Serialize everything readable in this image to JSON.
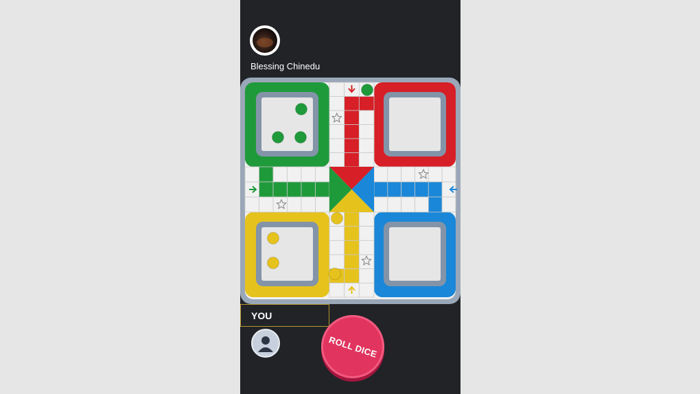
{
  "opponent": {
    "name": "Blessing Chinedu",
    "avatar_icon": "profile-photo"
  },
  "player": {
    "label": "YOU",
    "avatar_icon": "default-user-icon"
  },
  "roll_button": {
    "label": "ROLL DICE",
    "color": "#e1345f"
  },
  "board": {
    "colors": {
      "green": "#1f9a3b",
      "red": "#d61f26",
      "yellow": "#e6c21d",
      "blue": "#1a87d8",
      "frame": "#9aa7b8",
      "cell": "#f1f1f1"
    },
    "tokens": [
      {
        "color": "green",
        "location": "home-yard"
      },
      {
        "color": "green",
        "location": "home-yard"
      },
      {
        "color": "green",
        "location": "home-yard"
      },
      {
        "color": "green",
        "location": "track-top-start"
      },
      {
        "color": "yellow",
        "location": "home-yard"
      },
      {
        "color": "yellow",
        "location": "home-yard"
      },
      {
        "color": "yellow",
        "location": "track-bottom"
      },
      {
        "color": "yellow",
        "location": "track-bottom"
      }
    ],
    "safe_star_icon": "star-outline-icon",
    "start_arrows": [
      {
        "color": "red",
        "direction": "down"
      },
      {
        "color": "green",
        "direction": "right"
      },
      {
        "color": "blue",
        "direction": "left"
      },
      {
        "color": "yellow",
        "direction": "up"
      }
    ]
  }
}
